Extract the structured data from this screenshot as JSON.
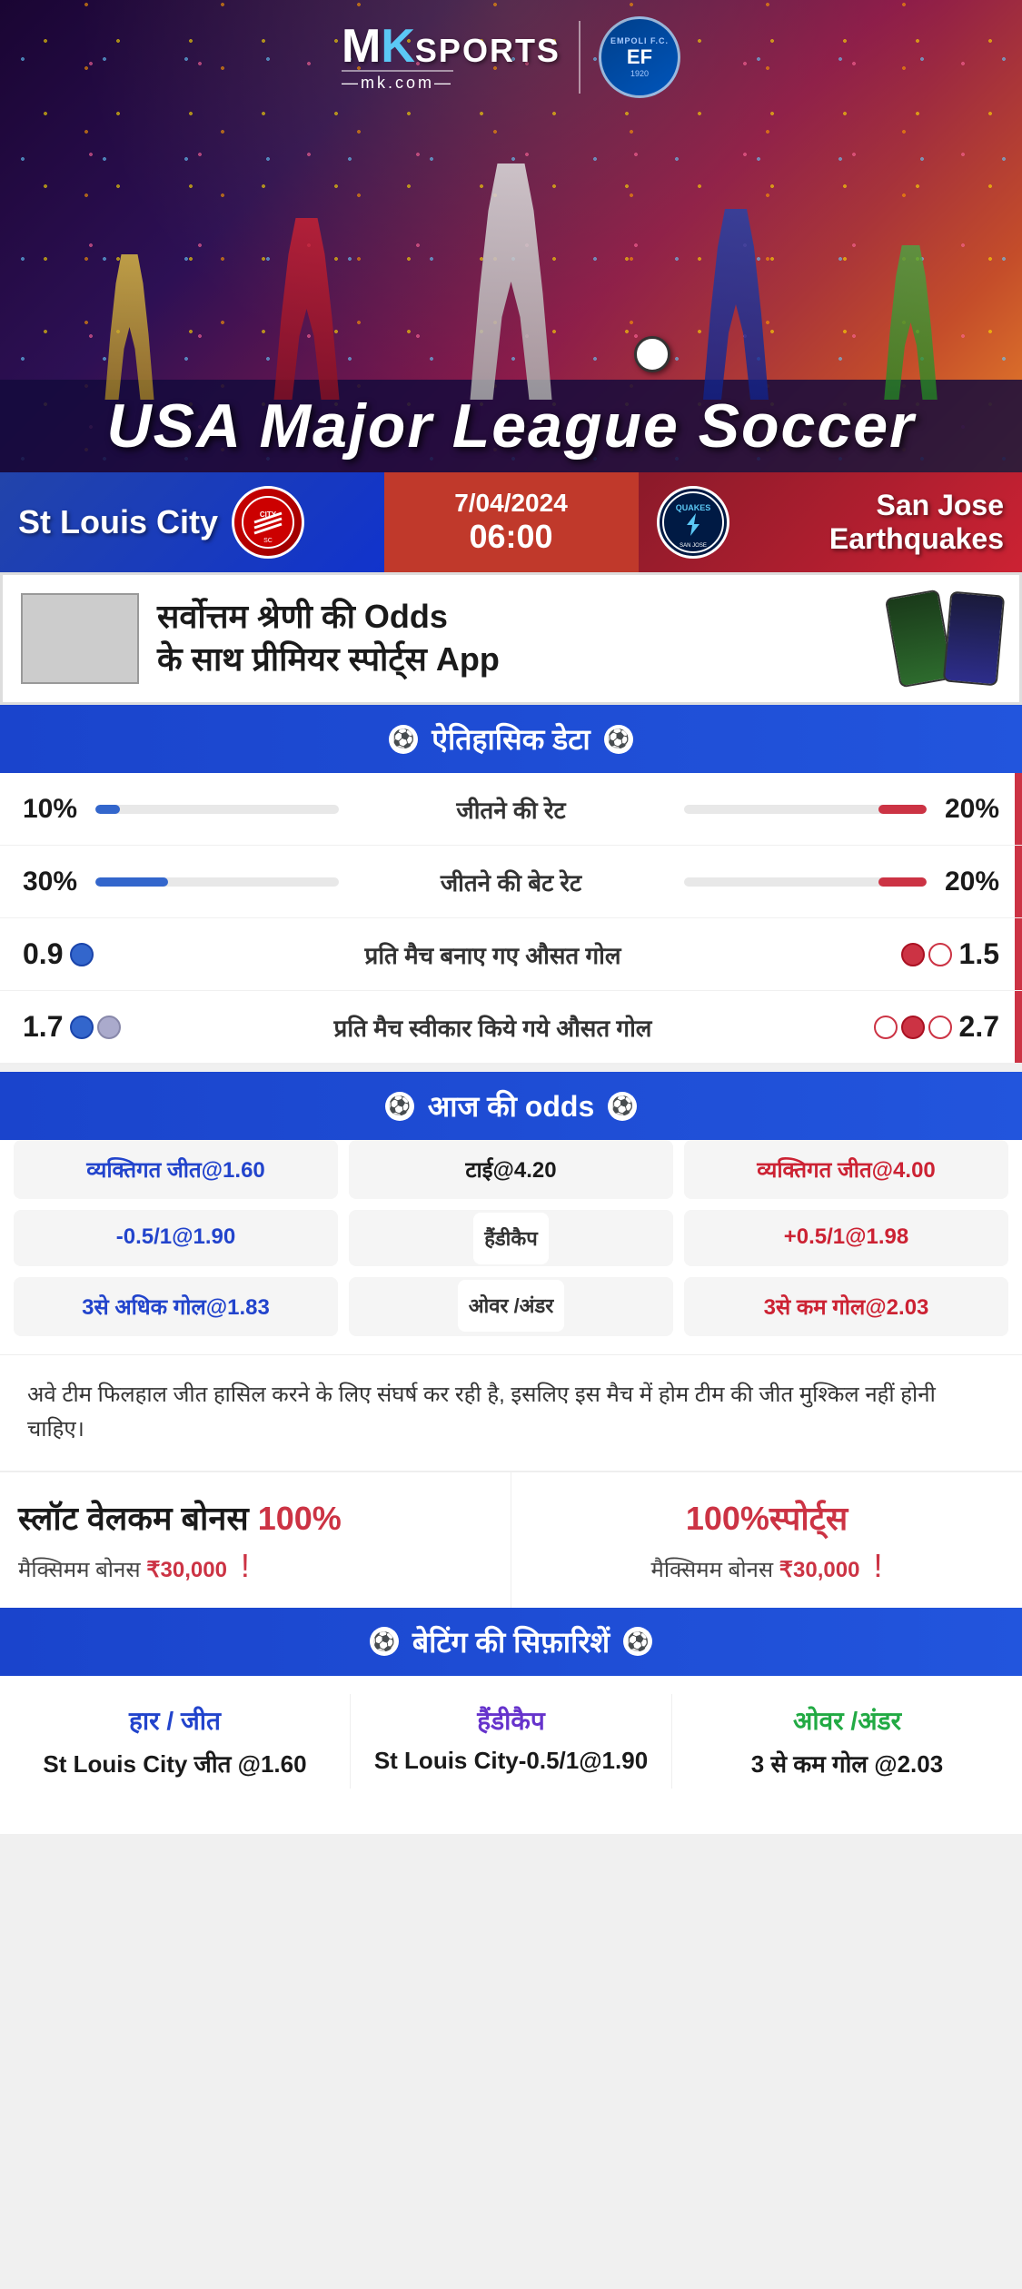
{
  "brand": {
    "mk_m": "M",
    "mk_k": "K",
    "sports": "SPORTS",
    "domain": "—mk.com—",
    "empoli_line1": "EMPOLI F.C.",
    "empoli_ef": "EF",
    "empoli_year": "1920"
  },
  "hero": {
    "title": "USA Major League Soccer"
  },
  "match": {
    "team_left": "St Louis City",
    "date": "7/04/2024",
    "time": "06:00",
    "team_right": "San Jose Earthquakes",
    "team_right_badge_top": "QUAKES",
    "team_right_badge_bottom": "San Jose Earthquakes"
  },
  "promo": {
    "text_line1": "सर्वोत्तम श्रेणी की Odds",
    "text_line2": "के साथ प्रीमियर स्पोर्ट्स App"
  },
  "historical": {
    "header": "ऐतिहासिक डेटा",
    "rows": [
      {
        "left_pct": "10%",
        "label": "जीतने की रेट",
        "right_pct": "20%",
        "left_fill": 10,
        "right_fill": 20
      },
      {
        "left_pct": "30%",
        "label": "जीतने की बेट रेट",
        "right_pct": "20%",
        "left_fill": 30,
        "right_fill": 20
      }
    ],
    "goal_rows": [
      {
        "left_val": "0.9",
        "label": "प्रति मैच बनाए गए औसत गोल",
        "right_val": "1.5",
        "left_balls": 1,
        "right_balls": 2
      },
      {
        "left_val": "1.7",
        "label": "प्रति मैच स्वीकार किये गये औसत गोल",
        "right_val": "2.7",
        "left_balls": 2,
        "right_balls": 3
      }
    ]
  },
  "odds": {
    "header": "आज की odds",
    "win_left": "व्यक्तिगत जीत@1.60",
    "tie": "टाई@4.20",
    "win_right": "व्यक्तिगत जीत@4.00",
    "handicap_left": "-0.5/1@1.90",
    "handicap_label": "हैंडीकैप",
    "handicap_right": "+0.5/1@1.98",
    "over_left": "3से अधिक गोल@1.83",
    "over_label": "ओवर /अंडर",
    "over_right": "3से कम गोल@2.03"
  },
  "analysis": {
    "text": "अवे टीम फिलहाल जीत हासिल करने के लिए संघर्ष कर रही है, इसलिए इस मैच में होम टीम की जीत मुश्किल नहीं होनी चाहिए।"
  },
  "bonus": {
    "left_title_main": "स्लॉट वेलकम बोनस 100%",
    "left_subtitle": "मैक्सिमम बोनस ₹30,000  !",
    "right_title": "100%स्पोर्ट्स",
    "right_subtitle": "मैक्सिमम बोनस  ₹30,000 !"
  },
  "betting_rec": {
    "header": "बेटिंग की सिफ़ारिशें",
    "col1_label": "हार / जीत",
    "col1_value": "St Louis City जीत @1.60",
    "col2_label": "हैंडीकैप",
    "col2_value": "St Louis City-0.5/1@1.90",
    "col3_label": "ओवर /अंडर",
    "col3_value": "3 से कम गोल @2.03"
  }
}
